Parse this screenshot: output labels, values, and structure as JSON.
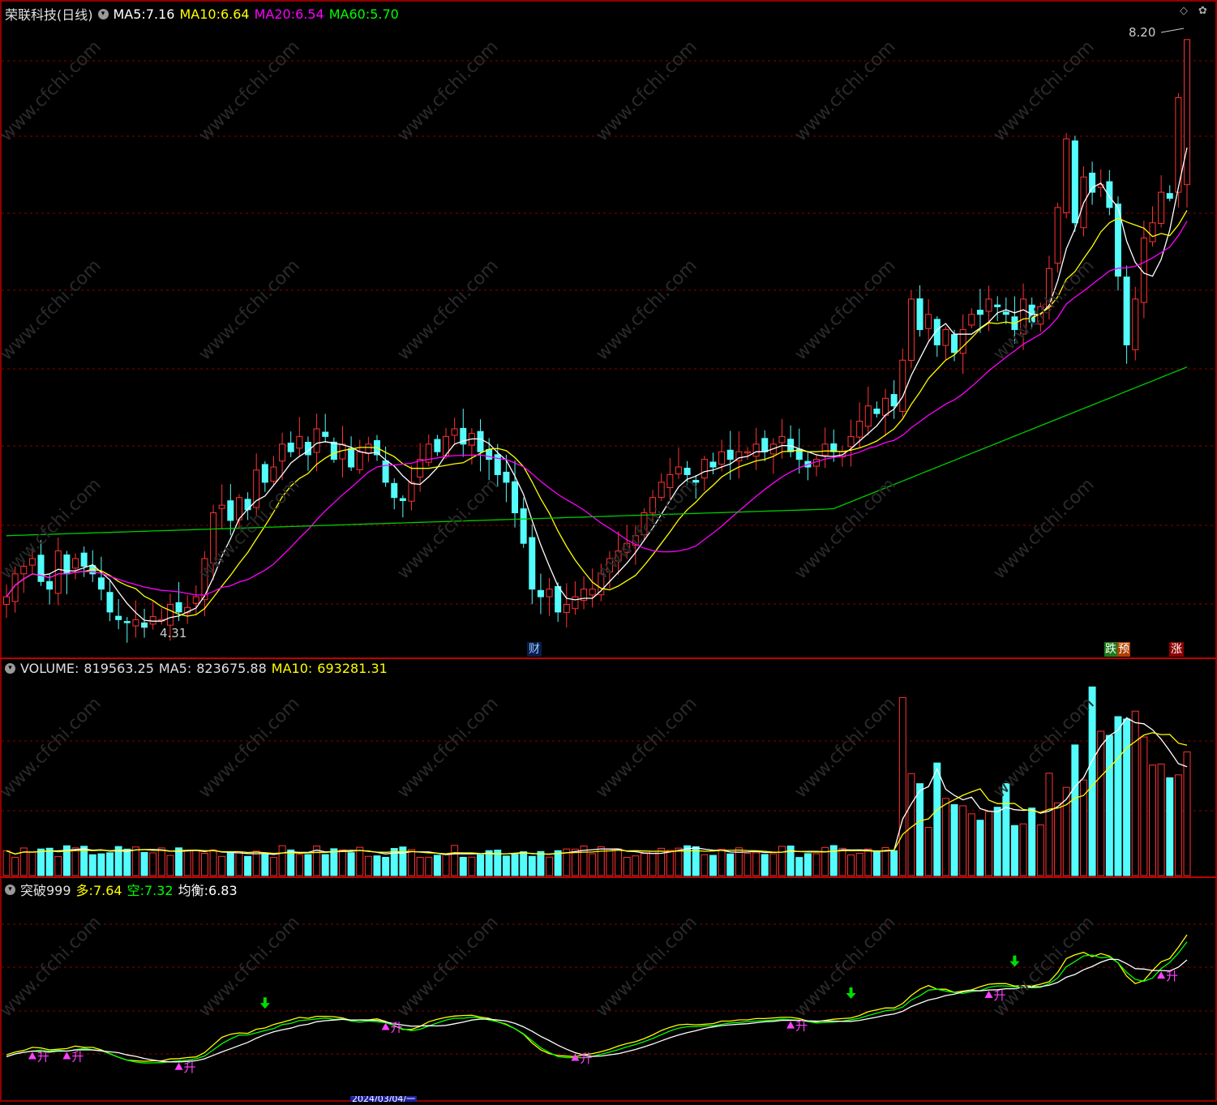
{
  "stock": {
    "name": "荣联科技(日线)",
    "ma": [
      {
        "label": "MA5:",
        "value": "7.16",
        "color": "#ffffff"
      },
      {
        "label": "MA10:",
        "value": "6.64",
        "color": "#ffff00"
      },
      {
        "label": "MA20:",
        "value": "6.54",
        "color": "#ff00ff"
      },
      {
        "label": "MA60:",
        "value": "5.70",
        "color": "#00ff00"
      }
    ],
    "price_high_label": "8.20",
    "price_low_label": "4.31",
    "badge_cai": "财",
    "badge_yu": "预",
    "badge_die": "跌",
    "badge_zhang": "涨"
  },
  "volume": {
    "label": "VOLUME:",
    "value": "819563.25",
    "ma5_label": "MA5:",
    "ma5_value": "823675.88",
    "ma10_label": "MA10:",
    "ma10_value": "693281.31"
  },
  "indicator": {
    "name": "突破999",
    "duo_label": "多:",
    "duo_value": "7.64",
    "kong_label": "空:",
    "kong_value": "7.32",
    "jun_label": "均衡:",
    "jun_value": "6.83",
    "sheng_label": "升"
  },
  "date_label": "2024/03/04/一",
  "watermark": "www.cfchi.com",
  "colors": {
    "up": "#ff3232",
    "down": "#54fcfc",
    "ma5": "#ffffff",
    "ma10": "#ffff00",
    "ma20": "#ff00ff",
    "ma60": "#00cc00",
    "grid": "#8b0000",
    "border": "#c00000"
  },
  "chart_data": {
    "type": "candlestick",
    "price_range": [
      4.2,
      8.3
    ],
    "close": [
      4.55,
      4.7,
      4.75,
      4.8,
      4.65,
      4.6,
      4.85,
      4.7,
      4.8,
      4.75,
      4.7,
      4.6,
      4.45,
      4.4,
      4.38,
      4.4,
      4.35,
      4.42,
      4.4,
      4.5,
      4.45,
      4.48,
      4.55,
      4.8,
      5.1,
      5.15,
      5.05,
      5.2,
      5.12,
      5.38,
      5.3,
      5.4,
      5.55,
      5.5,
      5.6,
      5.48,
      5.65,
      5.6,
      5.45,
      5.55,
      5.4,
      5.5,
      5.55,
      5.48,
      5.3,
      5.2,
      5.18,
      5.3,
      5.45,
      5.55,
      5.5,
      5.6,
      5.65,
      5.55,
      5.62,
      5.5,
      5.45,
      5.35,
      5.3,
      5.1,
      4.9,
      4.6,
      4.55,
      4.6,
      4.45,
      4.5,
      4.55,
      4.6,
      4.6,
      4.7,
      4.8,
      4.85,
      4.9,
      4.95,
      5.1,
      5.2,
      5.3,
      5.35,
      5.4,
      5.35,
      5.3,
      5.45,
      5.4,
      5.5,
      5.45,
      5.5,
      5.5,
      5.55,
      5.5,
      5.55,
      5.6,
      5.5,
      5.45,
      5.4,
      5.45,
      5.55,
      5.5,
      5.5,
      5.6,
      5.7,
      5.8,
      5.75,
      5.85,
      5.8,
      6.1,
      6.5,
      6.3,
      6.4,
      6.2,
      6.3,
      6.15,
      6.3,
      6.4,
      6.4,
      6.5,
      6.45,
      6.4,
      6.3,
      6.5,
      6.35,
      6.45,
      6.7,
      7.1,
      7.55,
      7.0,
      7.3,
      7.2,
      7.25,
      7.1,
      6.65,
      6.2,
      6.5,
      6.9,
      7.0,
      7.2,
      7.16,
      7.9,
      8.2
    ],
    "volume_range": [
      0,
      1300000
    ],
    "ma5_current": 7.16,
    "ma10_current": 6.64,
    "ma20_current": 6.54,
    "ma60_current": 5.7
  }
}
